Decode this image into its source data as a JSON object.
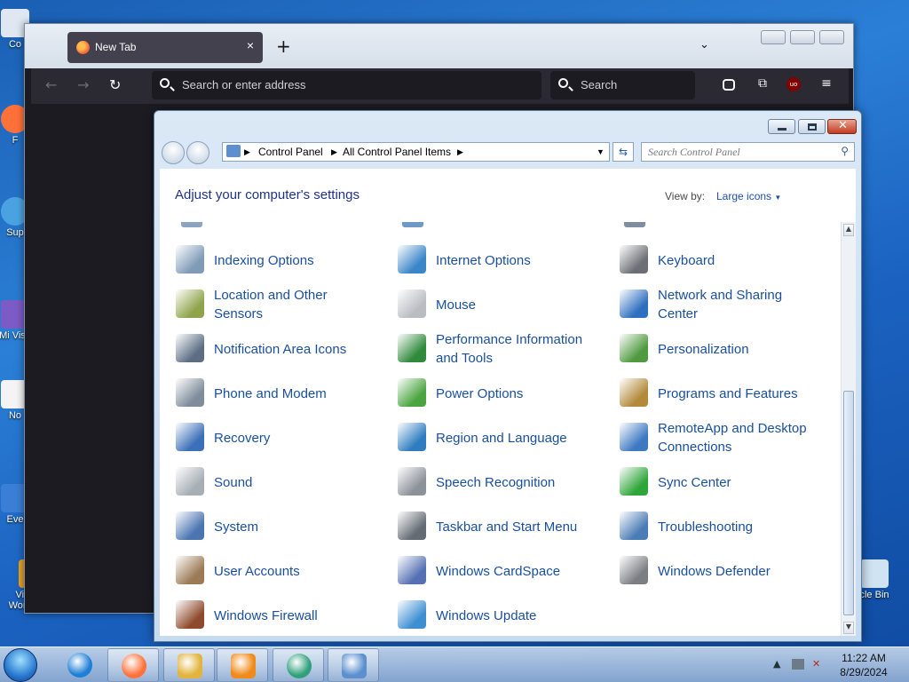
{
  "desktop": {
    "icons": [
      {
        "label": "Co",
        "color": "#dfe8f2"
      },
      {
        "label": "F",
        "color": "#ff7139"
      },
      {
        "label": "Sup",
        "color": "#4aa3e0"
      },
      {
        "label": "Mi Visu",
        "color": "#7d5bc7"
      },
      {
        "label": "No",
        "color": "#f4f4f4"
      },
      {
        "label": "Eve",
        "color": "#3a7fd5"
      },
      {
        "label": "Vivware Workstati...",
        "color": "#e8a020"
      },
      {
        "label": "cle Bin",
        "color": "#cfe3f3"
      }
    ]
  },
  "firefox": {
    "tab_title": "New Tab",
    "tab_close": "×",
    "new_tab": "+",
    "list_tabs": "⌄",
    "address_placeholder": "Search or enter address",
    "search_placeholder": "Search",
    "icons": [
      "back-icon",
      "forward-icon",
      "reload-icon",
      "pocket-icon",
      "extensions-icon",
      "ublock-icon",
      "menu-icon"
    ]
  },
  "control_panel": {
    "breadcrumb": [
      "Control Panel",
      "All Control Panel Items"
    ],
    "search_placeholder": "Search Control Panel",
    "heading": "Adjust your computer's settings",
    "view_by_label": "View by:",
    "view_by_value": "Large icons",
    "items": [
      {
        "label": "Indexing Options",
        "icon": "indexing-icon",
        "color": "#7f9bb8"
      },
      {
        "label": "Internet Options",
        "icon": "internet-options-icon",
        "color": "#3a86c8"
      },
      {
        "label": "Keyboard",
        "icon": "keyboard-icon",
        "color": "#6c6f75"
      },
      {
        "label": "Location and Other Sensors",
        "icon": "location-sensors-icon",
        "color": "#8fa44a"
      },
      {
        "label": "Mouse",
        "icon": "mouse-icon",
        "color": "#b9bcc1"
      },
      {
        "label": "Network and Sharing Center",
        "icon": "network-icon",
        "color": "#2f6fbf"
      },
      {
        "label": "Notification Area Icons",
        "icon": "notification-icon",
        "color": "#5d6e84"
      },
      {
        "label": "Performance Information and Tools",
        "icon": "performance-icon",
        "color": "#2f8a3c"
      },
      {
        "label": "Personalization",
        "icon": "personalization-icon",
        "color": "#4f9a3f"
      },
      {
        "label": "Phone and Modem",
        "icon": "phone-modem-icon",
        "color": "#7e8c9b"
      },
      {
        "label": "Power Options",
        "icon": "power-icon",
        "color": "#4aa540"
      },
      {
        "label": "Programs and Features",
        "icon": "programs-icon",
        "color": "#b28a3a"
      },
      {
        "label": "Recovery",
        "icon": "recovery-icon",
        "color": "#3b6fb8"
      },
      {
        "label": "Region and Language",
        "icon": "region-icon",
        "color": "#2f7dc0"
      },
      {
        "label": "RemoteApp and Desktop Connections",
        "icon": "remoteapp-icon",
        "color": "#3e78c2"
      },
      {
        "label": "Sound",
        "icon": "sound-icon",
        "color": "#a7aeb6"
      },
      {
        "label": "Speech Recognition",
        "icon": "microphone-icon",
        "color": "#8c9299"
      },
      {
        "label": "Sync Center",
        "icon": "sync-icon",
        "color": "#2fa63a"
      },
      {
        "label": "System",
        "icon": "system-icon",
        "color": "#4b74b0"
      },
      {
        "label": "Taskbar and Start Menu",
        "icon": "taskbar-icon",
        "color": "#646b73"
      },
      {
        "label": "Troubleshooting",
        "icon": "troubleshooting-icon",
        "color": "#4a7cb5"
      },
      {
        "label": "User Accounts",
        "icon": "user-accounts-icon",
        "color": "#9c7a55"
      },
      {
        "label": "Windows CardSpace",
        "icon": "cardspace-icon",
        "color": "#5671b3"
      },
      {
        "label": "Windows Defender",
        "icon": "defender-icon",
        "color": "#7b7e83"
      },
      {
        "label": "Windows Firewall",
        "icon": "firewall-icon",
        "color": "#8e4a2c"
      },
      {
        "label": "Windows Update",
        "icon": "windows-update-icon",
        "color": "#3d8fd2"
      }
    ]
  },
  "taskbar": {
    "buttons": [
      {
        "icon": "internet-explorer-icon",
        "color": "#1e7fd6"
      },
      {
        "icon": "firefox-icon",
        "color": "#ff7139"
      },
      {
        "icon": "file-explorer-icon",
        "color": "#e2b43f"
      },
      {
        "icon": "media-player-icon",
        "color": "#f08a1a"
      },
      {
        "icon": "vmware-icon",
        "color": "#2fa07a"
      },
      {
        "icon": "control-panel-icon",
        "color": "#5b8fcf"
      }
    ],
    "time": "11:22 AM",
    "date": "8/29/2024"
  }
}
